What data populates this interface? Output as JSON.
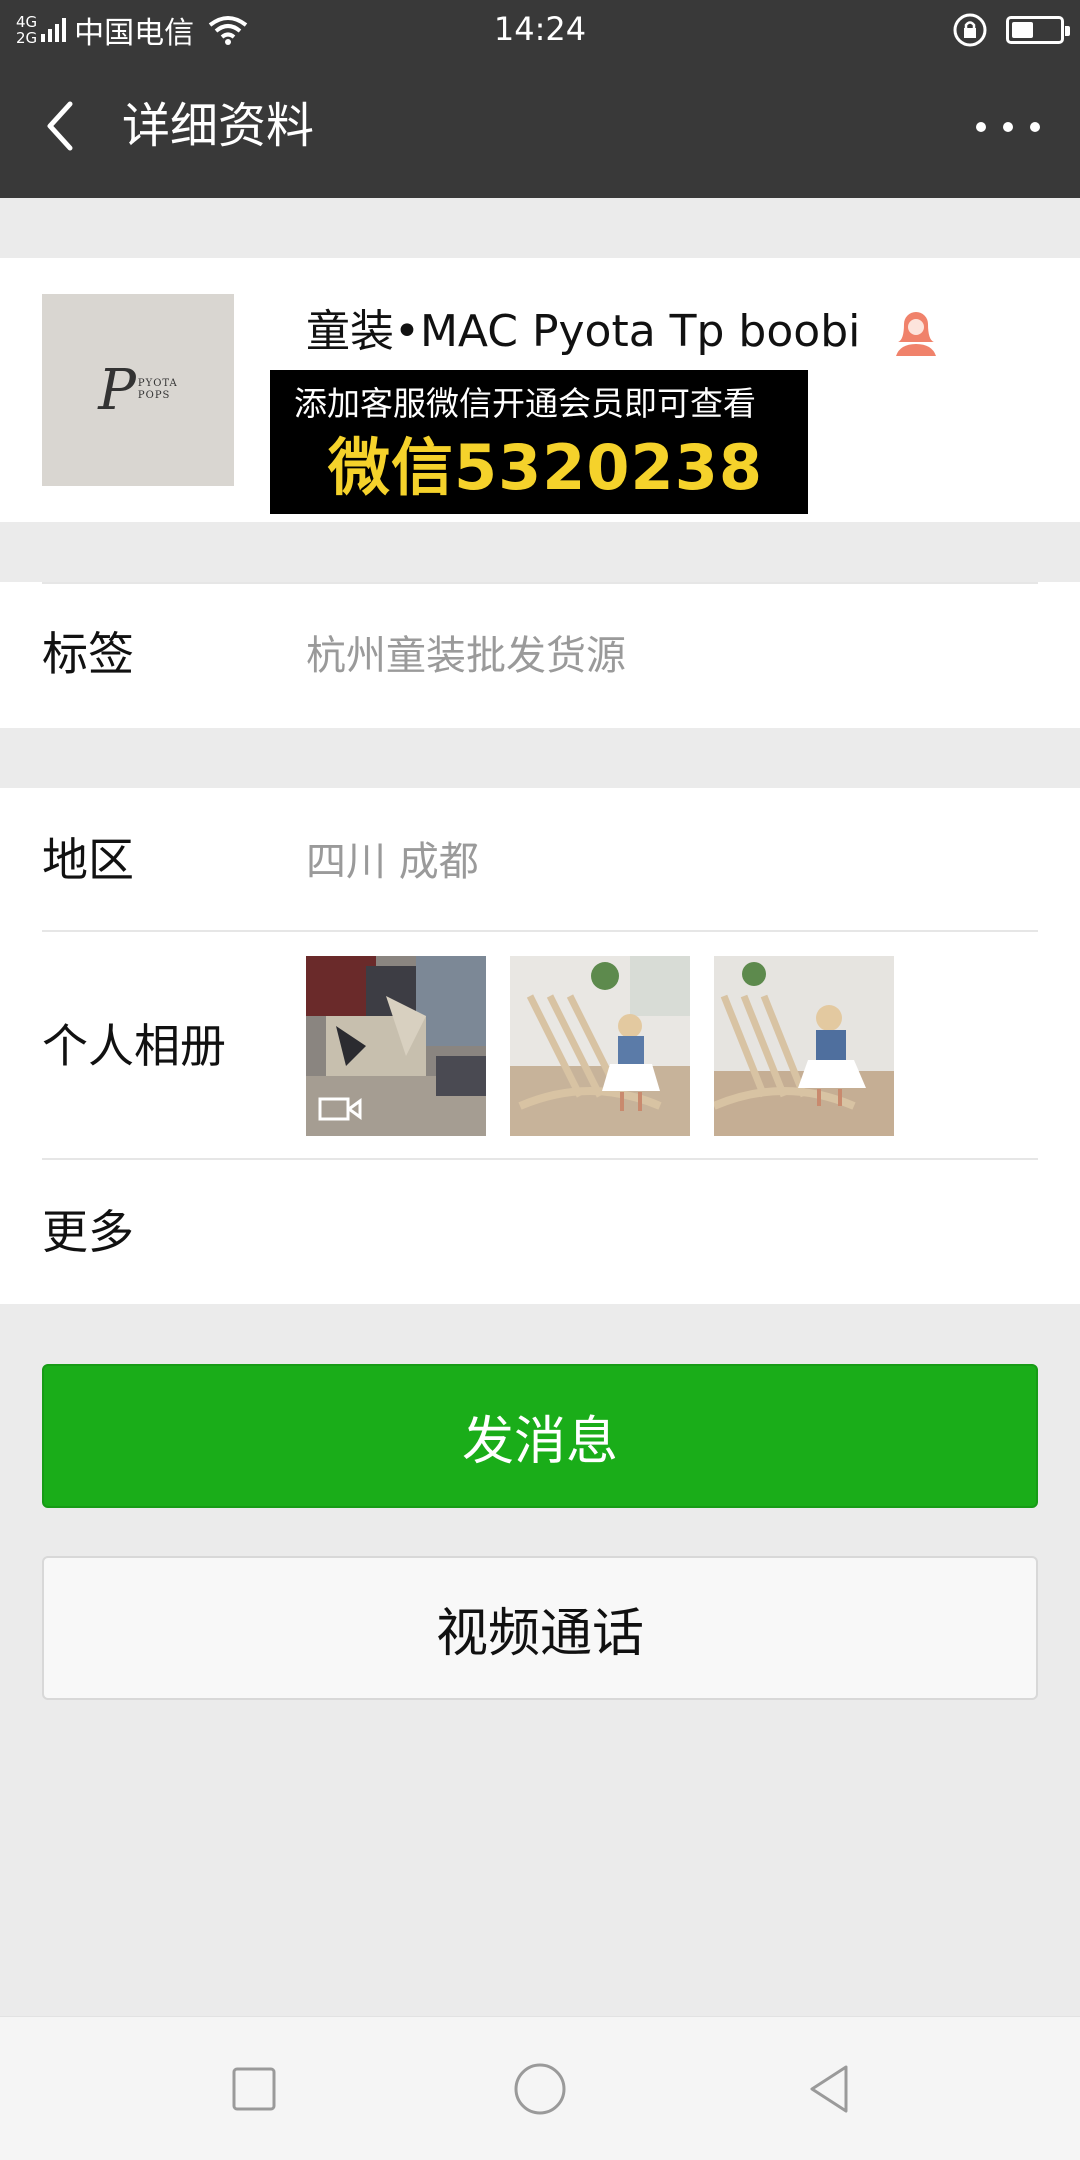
{
  "status_bar": {
    "network": "4G\n2G",
    "carrier": "中国电信",
    "time": "14:24",
    "battery_level": 0.45
  },
  "nav": {
    "title": "详细资料"
  },
  "profile": {
    "name": "童装•MAC  Pyota Tp boobi",
    "avatar_text": "PYOTA POPS",
    "gender_icon": "female-icon"
  },
  "ad": {
    "line1": "添加客服微信开通会员即可查看",
    "line2": "微信5320238"
  },
  "rows": {
    "tags": {
      "label": "标签",
      "value": "杭州童装批发货源"
    },
    "region": {
      "label": "地区",
      "value": "四川  成都"
    },
    "album": {
      "label": "个人相册"
    },
    "more": {
      "label": "更多"
    }
  },
  "buttons": {
    "send_message": "发消息",
    "video_call": "视频通话"
  },
  "colors": {
    "header": "#393939",
    "primary_green": "#1aad19",
    "background": "#ebebeb",
    "ad_yellow": "#f5d22b"
  }
}
